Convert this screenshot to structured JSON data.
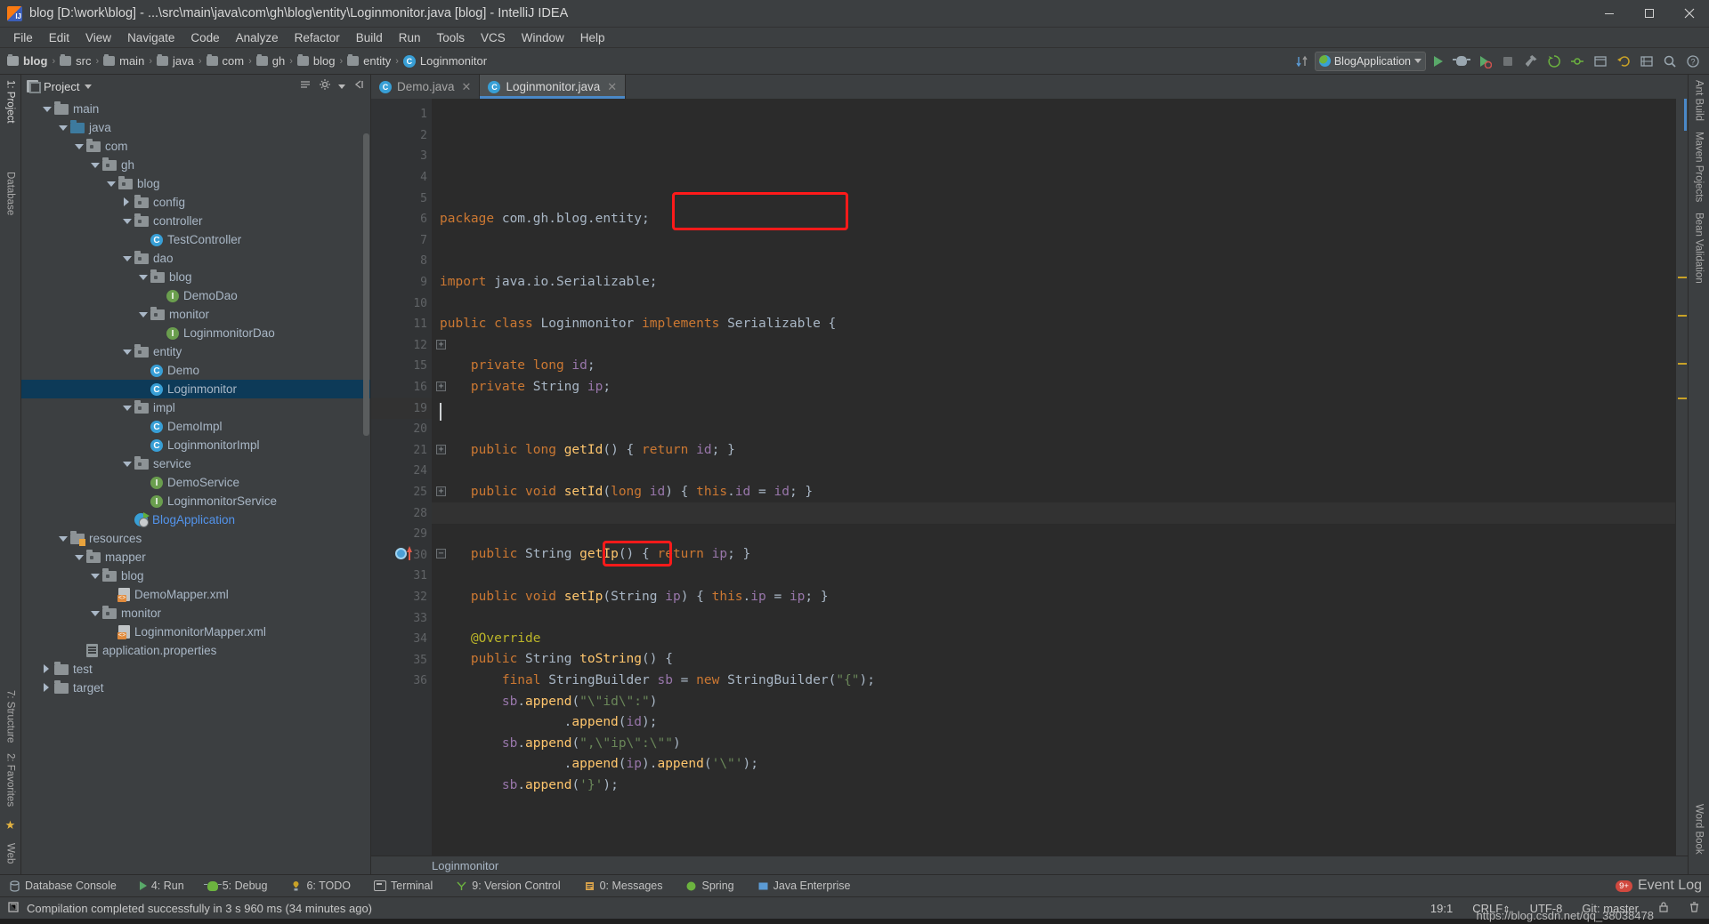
{
  "window": {
    "title": "blog [D:\\work\\blog] - ...\\src\\main\\java\\com\\gh\\blog\\entity\\Loginmonitor.java [blog] - IntelliJ IDEA",
    "minimize_label": "minimize-icon",
    "maximize_label": "maximize-icon",
    "close_label": "close-icon"
  },
  "menu": [
    "File",
    "Edit",
    "View",
    "Navigate",
    "Code",
    "Analyze",
    "Refactor",
    "Build",
    "Run",
    "Tools",
    "VCS",
    "Window",
    "Help"
  ],
  "navbar": {
    "crumbs": [
      "blog",
      "src",
      "main",
      "java",
      "com",
      "gh",
      "blog",
      "entity",
      "Loginmonitor"
    ],
    "run_config": "BlogApplication",
    "buttons": [
      "run-button",
      "debug-button",
      "coverage-button",
      "stop-button",
      "build-button"
    ]
  },
  "left_strip": {
    "top": [
      "1: Project"
    ],
    "bottom": [
      "7: Structure",
      "2: Favorites"
    ],
    "database_label": "Database"
  },
  "right_strip": [
    "Ant Build",
    "Maven Projects",
    "Bean Validation",
    "Word Book",
    "Web"
  ],
  "project_panel": {
    "title": "Project",
    "tree": [
      {
        "depth": 1,
        "twisty": "open",
        "icon": "folder",
        "label": "main",
        "color": ""
      },
      {
        "depth": 2,
        "twisty": "open",
        "icon": "folder-src",
        "label": "java",
        "color": ""
      },
      {
        "depth": 3,
        "twisty": "open",
        "icon": "folder-pkg",
        "label": "com",
        "color": ""
      },
      {
        "depth": 4,
        "twisty": "open",
        "icon": "folder-pkg",
        "label": "gh",
        "color": ""
      },
      {
        "depth": 5,
        "twisty": "open",
        "icon": "folder-pkg",
        "label": "blog",
        "color": ""
      },
      {
        "depth": 6,
        "twisty": "closed",
        "icon": "folder-pkg",
        "label": "config",
        "color": ""
      },
      {
        "depth": 6,
        "twisty": "open",
        "icon": "folder-pkg",
        "label": "controller",
        "color": ""
      },
      {
        "depth": 7,
        "twisty": "none",
        "icon": "cls",
        "label": "TestController",
        "color": ""
      },
      {
        "depth": 6,
        "twisty": "open",
        "icon": "folder-pkg",
        "label": "dao",
        "color": ""
      },
      {
        "depth": 7,
        "twisty": "open",
        "icon": "folder-pkg",
        "label": "blog",
        "color": ""
      },
      {
        "depth": 8,
        "twisty": "none",
        "icon": "iface",
        "label": "DemoDao",
        "color": ""
      },
      {
        "depth": 7,
        "twisty": "open",
        "icon": "folder-pkg",
        "label": "monitor",
        "color": ""
      },
      {
        "depth": 8,
        "twisty": "none",
        "icon": "iface",
        "label": "LoginmonitorDao",
        "color": ""
      },
      {
        "depth": 6,
        "twisty": "open",
        "icon": "folder-pkg",
        "label": "entity",
        "color": ""
      },
      {
        "depth": 7,
        "twisty": "none",
        "icon": "cls",
        "label": "Demo",
        "color": ""
      },
      {
        "depth": 7,
        "twisty": "none",
        "icon": "cls",
        "label": "Loginmonitor",
        "color": "",
        "selected": true
      },
      {
        "depth": 6,
        "twisty": "open",
        "icon": "folder-pkg",
        "label": "impl",
        "color": ""
      },
      {
        "depth": 7,
        "twisty": "none",
        "icon": "cls",
        "label": "DemoImpl",
        "color": ""
      },
      {
        "depth": 7,
        "twisty": "none",
        "icon": "cls",
        "label": "LoginmonitorImpl",
        "color": ""
      },
      {
        "depth": 6,
        "twisty": "open",
        "icon": "folder-pkg",
        "label": "service",
        "color": ""
      },
      {
        "depth": 7,
        "twisty": "none",
        "icon": "iface",
        "label": "DemoService",
        "color": ""
      },
      {
        "depth": 7,
        "twisty": "none",
        "icon": "iface",
        "label": "LoginmonitorService",
        "color": ""
      },
      {
        "depth": 6,
        "twisty": "none",
        "icon": "springboot",
        "label": "BlogApplication",
        "color": "blue"
      },
      {
        "depth": 2,
        "twisty": "open",
        "icon": "folder-res",
        "label": "resources",
        "color": ""
      },
      {
        "depth": 3,
        "twisty": "open",
        "icon": "folder-pkg",
        "label": "mapper",
        "color": ""
      },
      {
        "depth": 4,
        "twisty": "open",
        "icon": "folder-pkg",
        "label": "blog",
        "color": ""
      },
      {
        "depth": 5,
        "twisty": "none",
        "icon": "xml",
        "label": "DemoMapper.xml",
        "color": ""
      },
      {
        "depth": 4,
        "twisty": "open",
        "icon": "folder-pkg",
        "label": "monitor",
        "color": ""
      },
      {
        "depth": 5,
        "twisty": "none",
        "icon": "xml",
        "label": "LoginmonitorMapper.xml",
        "color": ""
      },
      {
        "depth": 3,
        "twisty": "none",
        "icon": "props",
        "label": "application.properties",
        "color": ""
      },
      {
        "depth": 1,
        "twisty": "closed",
        "icon": "folder",
        "label": "test",
        "color": ""
      },
      {
        "depth": 1,
        "twisty": "closed",
        "icon": "folder",
        "label": "target",
        "color": ""
      }
    ]
  },
  "editor": {
    "tabs": [
      {
        "label": "Demo.java",
        "active": false
      },
      {
        "label": "Loginmonitor.java",
        "active": true
      }
    ],
    "line_numbers": [
      "1",
      "2",
      "3",
      "4",
      "5",
      "6",
      "7",
      "8",
      "9",
      "10",
      "11",
      "12",
      "15",
      "16",
      "19",
      "20",
      "21",
      "24",
      "25",
      "28",
      "29",
      "30",
      "31",
      "32",
      "33",
      "34",
      "35",
      "36"
    ],
    "current_line": "19",
    "breadcrumb": "Loginmonitor",
    "lines": [
      {
        "n": "1",
        "text": "package com.gh.blog.entity;"
      },
      {
        "n": "2",
        "text": ""
      },
      {
        "n": "3",
        "text": ""
      },
      {
        "n": "4",
        "text": "import java.io.Serializable;"
      },
      {
        "n": "5",
        "text": ""
      },
      {
        "n": "6",
        "text": "public class Loginmonitor implements Serializable {"
      },
      {
        "n": "7",
        "text": ""
      },
      {
        "n": "8",
        "text": "    private long id;"
      },
      {
        "n": "9",
        "text": "    private String ip;"
      },
      {
        "n": "10",
        "text": ""
      },
      {
        "n": "11",
        "text": ""
      },
      {
        "n": "12",
        "text": "    public long getId() { return id; }"
      },
      {
        "n": "15",
        "text": ""
      },
      {
        "n": "16",
        "text": "    public void setId(long id) { this.id = id; }"
      },
      {
        "n": "19",
        "text": ""
      },
      {
        "n": "20",
        "text": ""
      },
      {
        "n": "21",
        "text": "    public String getIp() { return ip; }"
      },
      {
        "n": "24",
        "text": ""
      },
      {
        "n": "25",
        "text": "    public void setIp(String ip) { this.ip = ip; }"
      },
      {
        "n": "28",
        "text": ""
      },
      {
        "n": "29",
        "text": "    @Override"
      },
      {
        "n": "30",
        "text": "    public String toString() {"
      },
      {
        "n": "31",
        "text": "        final StringBuilder sb = new StringBuilder(\"{\");"
      },
      {
        "n": "32",
        "text": "        sb.append(\"\\\"id\\\":\")"
      },
      {
        "n": "33",
        "text": "                .append(id);"
      },
      {
        "n": "34",
        "text": "        sb.append(\",\\\"ip\\\":\\\"\")"
      },
      {
        "n": "35",
        "text": "                .append(ip).append('\\\"');"
      },
      {
        "n": "36",
        "text": "        sb.append('}');"
      }
    ],
    "highlights": [
      {
        "name": "implements-serializable-highlight",
        "text": "implements Serializable"
      },
      {
        "name": "tostring-highlight",
        "text": "toString()"
      }
    ]
  },
  "tool_windows": [
    {
      "label": "Database Console",
      "icon": "database-icon"
    },
    {
      "label": "4: Run",
      "icon": "run-icon"
    },
    {
      "label": "5: Debug",
      "icon": "debug-icon"
    },
    {
      "label": "6: TODO",
      "icon": "todo-icon"
    },
    {
      "label": "Terminal",
      "icon": "terminal-icon"
    },
    {
      "label": "9: Version Control",
      "icon": "vcs-icon"
    },
    {
      "label": "0: Messages",
      "icon": "messages-icon"
    },
    {
      "label": "Spring",
      "icon": "spring-icon"
    },
    {
      "label": "Java Enterprise",
      "icon": "java-enterprise-icon"
    }
  ],
  "event_log": {
    "label": "Event Log",
    "badge": "9+"
  },
  "status": {
    "message": "Compilation completed successfully in 3 s 960 ms (34 minutes ago)",
    "caret": "19:1",
    "line_sep": "CRLF",
    "encoding": "UTF-8",
    "branch": "Git: master",
    "watermark": "https://blog.csdn.net/qq_38038478",
    "lock_icon": "lock-icon"
  }
}
